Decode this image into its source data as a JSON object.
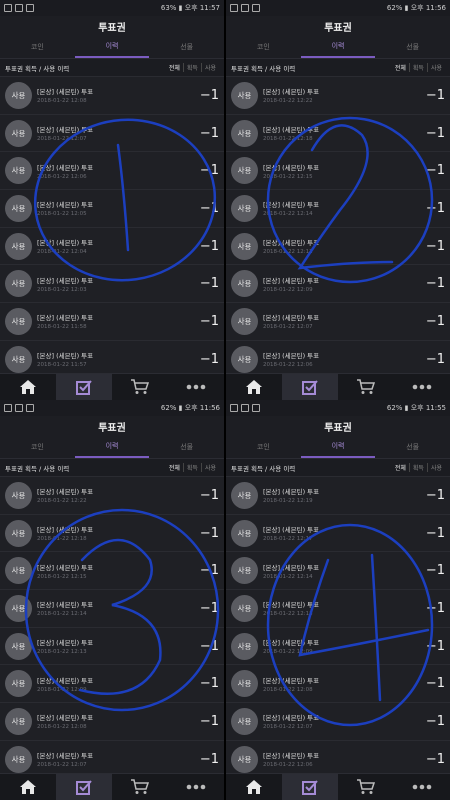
{
  "screens": [
    {
      "status_time": "63% ▮ 오후 11:57",
      "title": "투표권",
      "tabs": [
        "코인",
        "이력",
        "선물"
      ],
      "active_tab": 1,
      "section_title": "투표권 획득 / 사용 이력",
      "filters": [
        "전체",
        "획득",
        "사용"
      ],
      "rows": [
        {
          "badge": "사용",
          "title": "[본상] (세븐틴) 투표",
          "date": "2018-01-22 12:08",
          "value": "−1"
        },
        {
          "badge": "사용",
          "title": "[본상] (세븐틴) 투표",
          "date": "2018-01-22 12:07",
          "value": "−1"
        },
        {
          "badge": "사용",
          "title": "[본상] (세븐틴) 투표",
          "date": "2018-01-22 12:06",
          "value": "−1"
        },
        {
          "badge": "사용",
          "title": "[본상] (세븐틴) 투표",
          "date": "2018-01-22 12:05",
          "value": "−1"
        },
        {
          "badge": "사용",
          "title": "[본상] (세븐틴) 투표",
          "date": "2018-01-22 12:04",
          "value": "−1"
        },
        {
          "badge": "사용",
          "title": "[본상] (세븐틴) 투표",
          "date": "2018-01-22 12:03",
          "value": "−1"
        },
        {
          "badge": "사용",
          "title": "[본상] (세븐틴) 투표",
          "date": "2018-01-22 11:58",
          "value": "−1"
        },
        {
          "badge": "사용",
          "title": "[본상] (세븐틴) 투표",
          "date": "2018-01-22 11:57",
          "value": "−1"
        }
      ]
    },
    {
      "status_time": "62% ▮ 오후 11:56",
      "title": "투표권",
      "tabs": [
        "코인",
        "이력",
        "선물"
      ],
      "active_tab": 1,
      "section_title": "투표권 획득 / 사용 이력",
      "filters": [
        "전체",
        "획득",
        "사용"
      ],
      "rows": [
        {
          "badge": "사용",
          "title": "[본상] (세븐틴) 투표",
          "date": "2018-01-22 12:22",
          "value": "−1"
        },
        {
          "badge": "사용",
          "title": "[본상] (세븐틴) 투표",
          "date": "2018-01-22 12:18",
          "value": "−1"
        },
        {
          "badge": "사용",
          "title": "[본상] (세븐틴) 투표",
          "date": "2018-01-22 12:15",
          "value": "−1"
        },
        {
          "badge": "사용",
          "title": "[본상] (세븐틴) 투표",
          "date": "2018-01-22 12:14",
          "value": "−1"
        },
        {
          "badge": "사용",
          "title": "[본상] (세븐틴) 투표",
          "date": "2018-01-22 12:12",
          "value": "−1"
        },
        {
          "badge": "사용",
          "title": "[본상] (세븐틴) 투표",
          "date": "2018-01-22 12:09",
          "value": "−1"
        },
        {
          "badge": "사용",
          "title": "[본상] (세븐틴) 투표",
          "date": "2018-01-22 12:07",
          "value": "−1"
        },
        {
          "badge": "사용",
          "title": "[본상] (세븐틴) 투표",
          "date": "2018-01-22 12:06",
          "value": "−1"
        }
      ]
    },
    {
      "status_time": "62% ▮ 오후 11:56",
      "title": "투표권",
      "tabs": [
        "코인",
        "이력",
        "선물"
      ],
      "active_tab": 1,
      "section_title": "투표권 획득 / 사용 이력",
      "filters": [
        "전체",
        "획득",
        "사용"
      ],
      "rows": [
        {
          "badge": "사용",
          "title": "[본상] (세븐틴) 투표",
          "date": "2018-01-22 12:22",
          "value": "−1"
        },
        {
          "badge": "사용",
          "title": "[본상] (세븐틴) 투표",
          "date": "2018-01-22 12:18",
          "value": "−1"
        },
        {
          "badge": "사용",
          "title": "[본상] (세븐틴) 투표",
          "date": "2018-01-22 12:15",
          "value": "−1"
        },
        {
          "badge": "사용",
          "title": "[본상] (세븐틴) 투표",
          "date": "2018-01-22 12:14",
          "value": "−1"
        },
        {
          "badge": "사용",
          "title": "[본상] (세븐틴) 투표",
          "date": "2018-01-22 12:13",
          "value": "−1"
        },
        {
          "badge": "사용",
          "title": "[본상] (세븐틴) 투표",
          "date": "2018-01-22 12:09",
          "value": "−1"
        },
        {
          "badge": "사용",
          "title": "[본상] (세븐틴) 투표",
          "date": "2018-01-22 12:08",
          "value": "−1"
        },
        {
          "badge": "사용",
          "title": "[본상] (세븐틴) 투표",
          "date": "2018-01-22 12:07",
          "value": "−1"
        }
      ]
    },
    {
      "status_time": "62% ▮ 오후 11:55",
      "title": "투표권",
      "tabs": [
        "코인",
        "이력",
        "선물"
      ],
      "active_tab": 1,
      "section_title": "투표권 획득 / 사용 이력",
      "filters": [
        "전체",
        "획득",
        "사용"
      ],
      "rows": [
        {
          "badge": "사용",
          "title": "[본상] (세븐틴) 투표",
          "date": "2018-01-22 12:19",
          "value": "−1"
        },
        {
          "badge": "사용",
          "title": "[본상] (세븐틴) 투표",
          "date": "2018-01-22 12:17",
          "value": "−1"
        },
        {
          "badge": "사용",
          "title": "[본상] (세븐틴) 투표",
          "date": "2018-01-22 12:14",
          "value": "−1"
        },
        {
          "badge": "사용",
          "title": "[본상] (세븐틴) 투표",
          "date": "2018-01-22 12:13",
          "value": "−1"
        },
        {
          "badge": "사용",
          "title": "[본상] (세븐틴) 투표",
          "date": "2018-01-22 12:09",
          "value": "−1"
        },
        {
          "badge": "사용",
          "title": "[본상] (세븐틴) 투표",
          "date": "2018-01-22 12:08",
          "value": "−1"
        },
        {
          "badge": "사용",
          "title": "[본상] (세븐틴) 투표",
          "date": "2018-01-22 12:07",
          "value": "−1"
        },
        {
          "badge": "사용",
          "title": "[본상] (세븐틴) 투표",
          "date": "2018-01-22 12:06",
          "value": "−1"
        }
      ]
    }
  ],
  "annotations": [
    "1",
    "2",
    "3",
    "4"
  ],
  "accent_color": "#7b5cc0",
  "annotation_color": "#1c3fbf"
}
